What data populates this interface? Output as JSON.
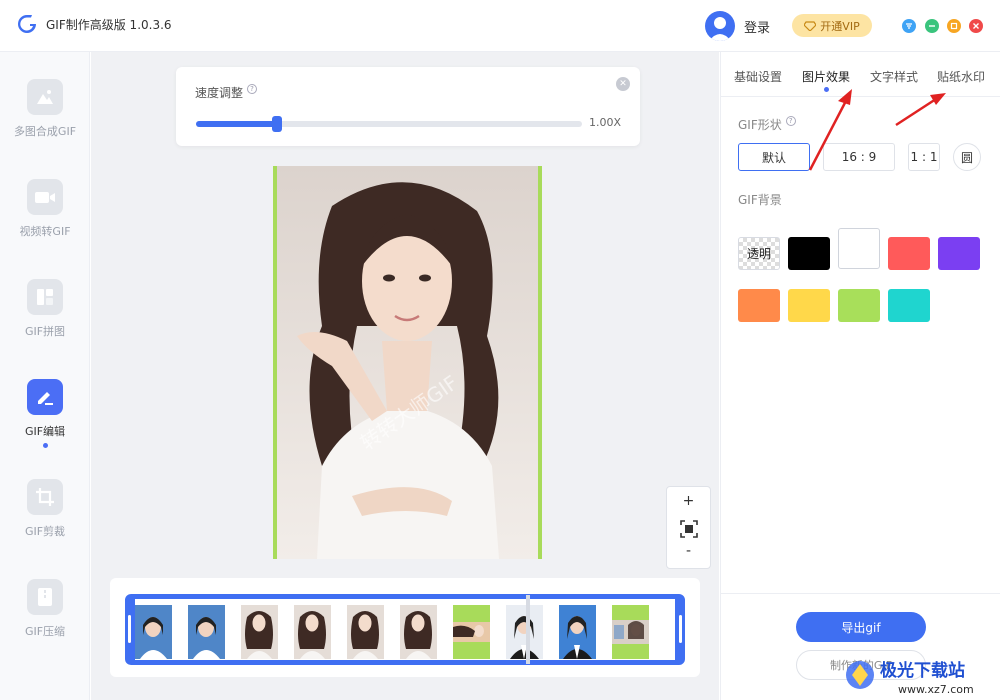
{
  "app": {
    "title": "GIF制作高级版 1.0.3.6",
    "login": "登录",
    "vip": "开通VIP"
  },
  "sidebar": {
    "items": [
      {
        "label": "多图合成GIF"
      },
      {
        "label": "视频转GIF"
      },
      {
        "label": "GIF拼图"
      },
      {
        "label": "GIF编辑",
        "active": true
      },
      {
        "label": "GIF剪裁"
      },
      {
        "label": "GIF压缩"
      }
    ]
  },
  "speed": {
    "label": "速度调整",
    "value_text": "1.00X",
    "level": 0.21
  },
  "zoom": {
    "plus": "+",
    "minus": "-"
  },
  "watermark_text": "转转大师GIF",
  "tabs": [
    {
      "label": "基础设置"
    },
    {
      "label": "图片效果",
      "active": true
    },
    {
      "label": "文字样式"
    },
    {
      "label": "贴纸水印"
    }
  ],
  "shape": {
    "title": "GIF形状",
    "options": [
      {
        "label": "默认",
        "active": true
      },
      {
        "label": "16 : 9"
      },
      {
        "label": "1 : 1"
      },
      {
        "label": "圆"
      }
    ]
  },
  "background": {
    "title": "GIF背景",
    "transparent_label": "透明",
    "colors": [
      "#000000",
      "#ffffff",
      "#ff5a5a",
      "#7b3ff2",
      "#ff8a4a",
      "#ffd84a",
      "#a8df5a",
      "#1fd5cf"
    ]
  },
  "actions": {
    "export": "导出gif",
    "new": "制作新的GIF"
  },
  "site_watermark": {
    "text": "极光下载站",
    "url": "www.xz7.com"
  },
  "colors": {
    "accent": "#3f6ff2",
    "frame_green": "#a8db5a"
  }
}
